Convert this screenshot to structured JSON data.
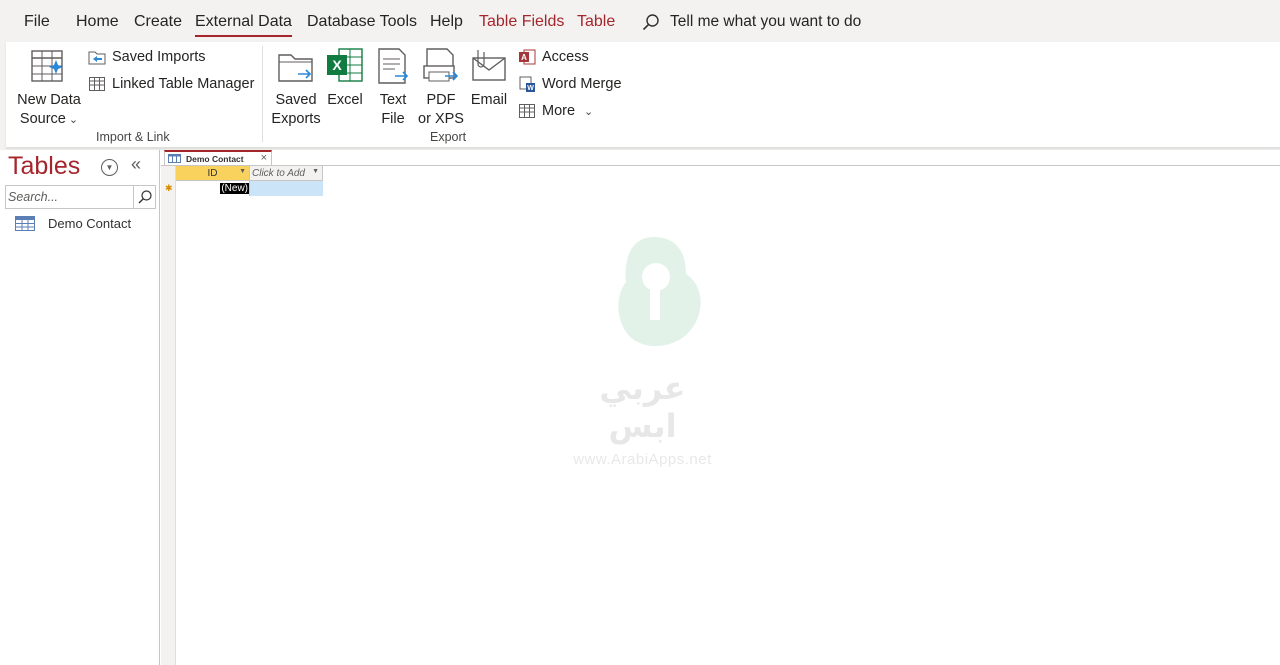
{
  "menu": {
    "tabs": [
      {
        "label": "File"
      },
      {
        "label": "Home"
      },
      {
        "label": "Create"
      },
      {
        "label": "External Data"
      },
      {
        "label": "Database Tools"
      },
      {
        "label": "Help"
      },
      {
        "label": "Table Fields"
      },
      {
        "label": "Table"
      }
    ],
    "active_tab": "External Data",
    "tell_me": "Tell me what you want to do"
  },
  "ribbon": {
    "import_link": {
      "group_label": "Import & Link",
      "new_data_source": {
        "line1": "New Data",
        "line2": "Source"
      },
      "saved_imports": "Saved Imports",
      "linked_table_manager": "Linked Table Manager"
    },
    "export": {
      "group_label": "Export",
      "saved_exports": {
        "line1": "Saved",
        "line2": "Exports"
      },
      "excel": "Excel",
      "text_file": {
        "line1": "Text",
        "line2": "File"
      },
      "pdf_xps": {
        "line1": "PDF",
        "line2": "or XPS"
      },
      "email": "Email",
      "access": "Access",
      "word_merge": "Word Merge",
      "more": "More"
    }
  },
  "nav_pane": {
    "title": "Tables",
    "search_placeholder": "Search...",
    "items": [
      {
        "label": "Demo Contact",
        "icon": "table-icon"
      }
    ]
  },
  "document": {
    "tab_label": "Demo Contact",
    "columns": [
      {
        "label": "ID"
      },
      {
        "label": "Click to Add"
      }
    ],
    "new_row_value": "(New)"
  },
  "watermark": {
    "arabic_text": "عربي ابس",
    "url": "www.ArabiApps.net"
  },
  "colors": {
    "accent": "#a4262c",
    "header_highlight": "#f9d25e",
    "selected_cell": "#cce4f7",
    "excel_green": "#107c41"
  }
}
